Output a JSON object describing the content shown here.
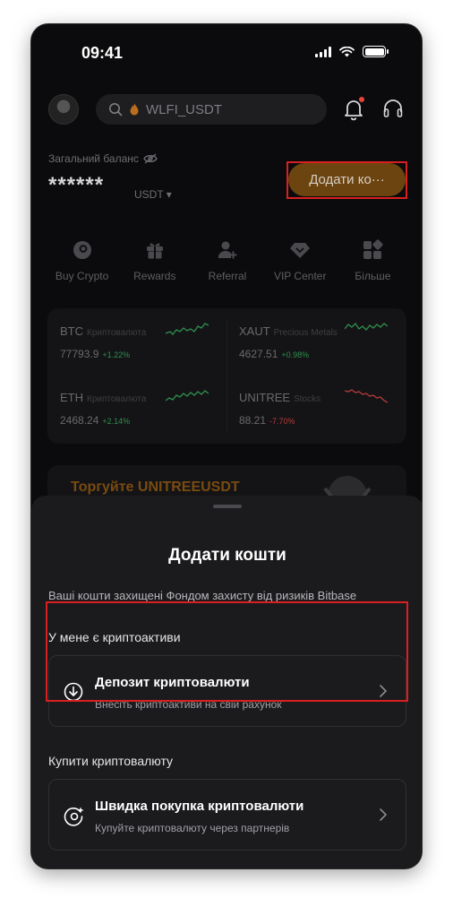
{
  "status_bar": {
    "time": "09:41"
  },
  "header": {
    "search_text": "WLFI_USDT"
  },
  "balance": {
    "label": "Загальний баланс",
    "masked_value": "******",
    "currency": "USDT",
    "add_button_label": "Додати ко···"
  },
  "actions": [
    {
      "label": "Buy Crypto",
      "icon": "buy-crypto-icon"
    },
    {
      "label": "Rewards",
      "icon": "gift-icon"
    },
    {
      "label": "Referral",
      "icon": "add-user-icon"
    },
    {
      "label": "VIP Center",
      "icon": "diamond-icon"
    },
    {
      "label": "Більше",
      "icon": "grid-more-icon"
    }
  ],
  "market": [
    {
      "name": "BTC",
      "category": "Криптовалюта",
      "price": "77793.9",
      "change": "+1.22%",
      "trend": "up"
    },
    {
      "name": "XAUT",
      "category": "Precious Metals",
      "price": "4627.51",
      "change": "+0.98%",
      "trend": "up"
    },
    {
      "name": "ETH",
      "category": "Криптовалюта",
      "price": "2468.24",
      "change": "+2.14%",
      "trend": "up"
    },
    {
      "name": "UNITREE",
      "category": "Stocks",
      "price": "88.21",
      "change": "-7.70%",
      "trend": "down"
    }
  ],
  "banner": {
    "text": "Торгуйте UNITREEUSDT"
  },
  "sheet": {
    "title": "Додати кошти",
    "note": "Ваші кошти захищені Фондом захисту від ризиків Bitbase",
    "section_have": "У мене є криптоактиви",
    "deposit_title": "Депозит криптовалюти",
    "deposit_sub": "Внесіть криптоактиви на свій рахунок",
    "section_buy": "Купити криптовалюту",
    "quick_title": "Швидка покупка криптовалюти",
    "quick_sub": "Купуйте криптовалюту через партнерів"
  },
  "colors": {
    "up": "#2f8f4e",
    "down": "#b43a3a",
    "accent": "#6b4410",
    "highlight": "#d91f1f"
  }
}
